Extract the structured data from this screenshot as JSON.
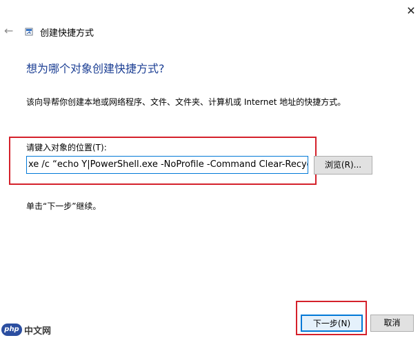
{
  "window": {
    "close_glyph": "✕",
    "back_glyph": "←",
    "title": "创建快捷方式"
  },
  "wizard": {
    "heading": "想为哪个对象创建快捷方式?",
    "description": "该向导帮你创建本地或网络程序、文件、文件夹、计算机或 Internet 地址的快捷方式。",
    "field_label": "请键入对象的位置(T):",
    "target_value": "xe /c “echo Y|PowerShell.exe -NoProfile -Command Clear-RecycleBin",
    "browse_label": "浏览(R)...",
    "continue_hint": "单击“下一步”继续。"
  },
  "footer": {
    "next_label": "下一步(N)",
    "cancel_label": "取消"
  },
  "watermark": {
    "logo_text": "php",
    "site_text": "中文网"
  },
  "colors": {
    "heading": "#1c3f94",
    "highlight_border": "#d4202a",
    "focus_border": "#0078d7"
  }
}
